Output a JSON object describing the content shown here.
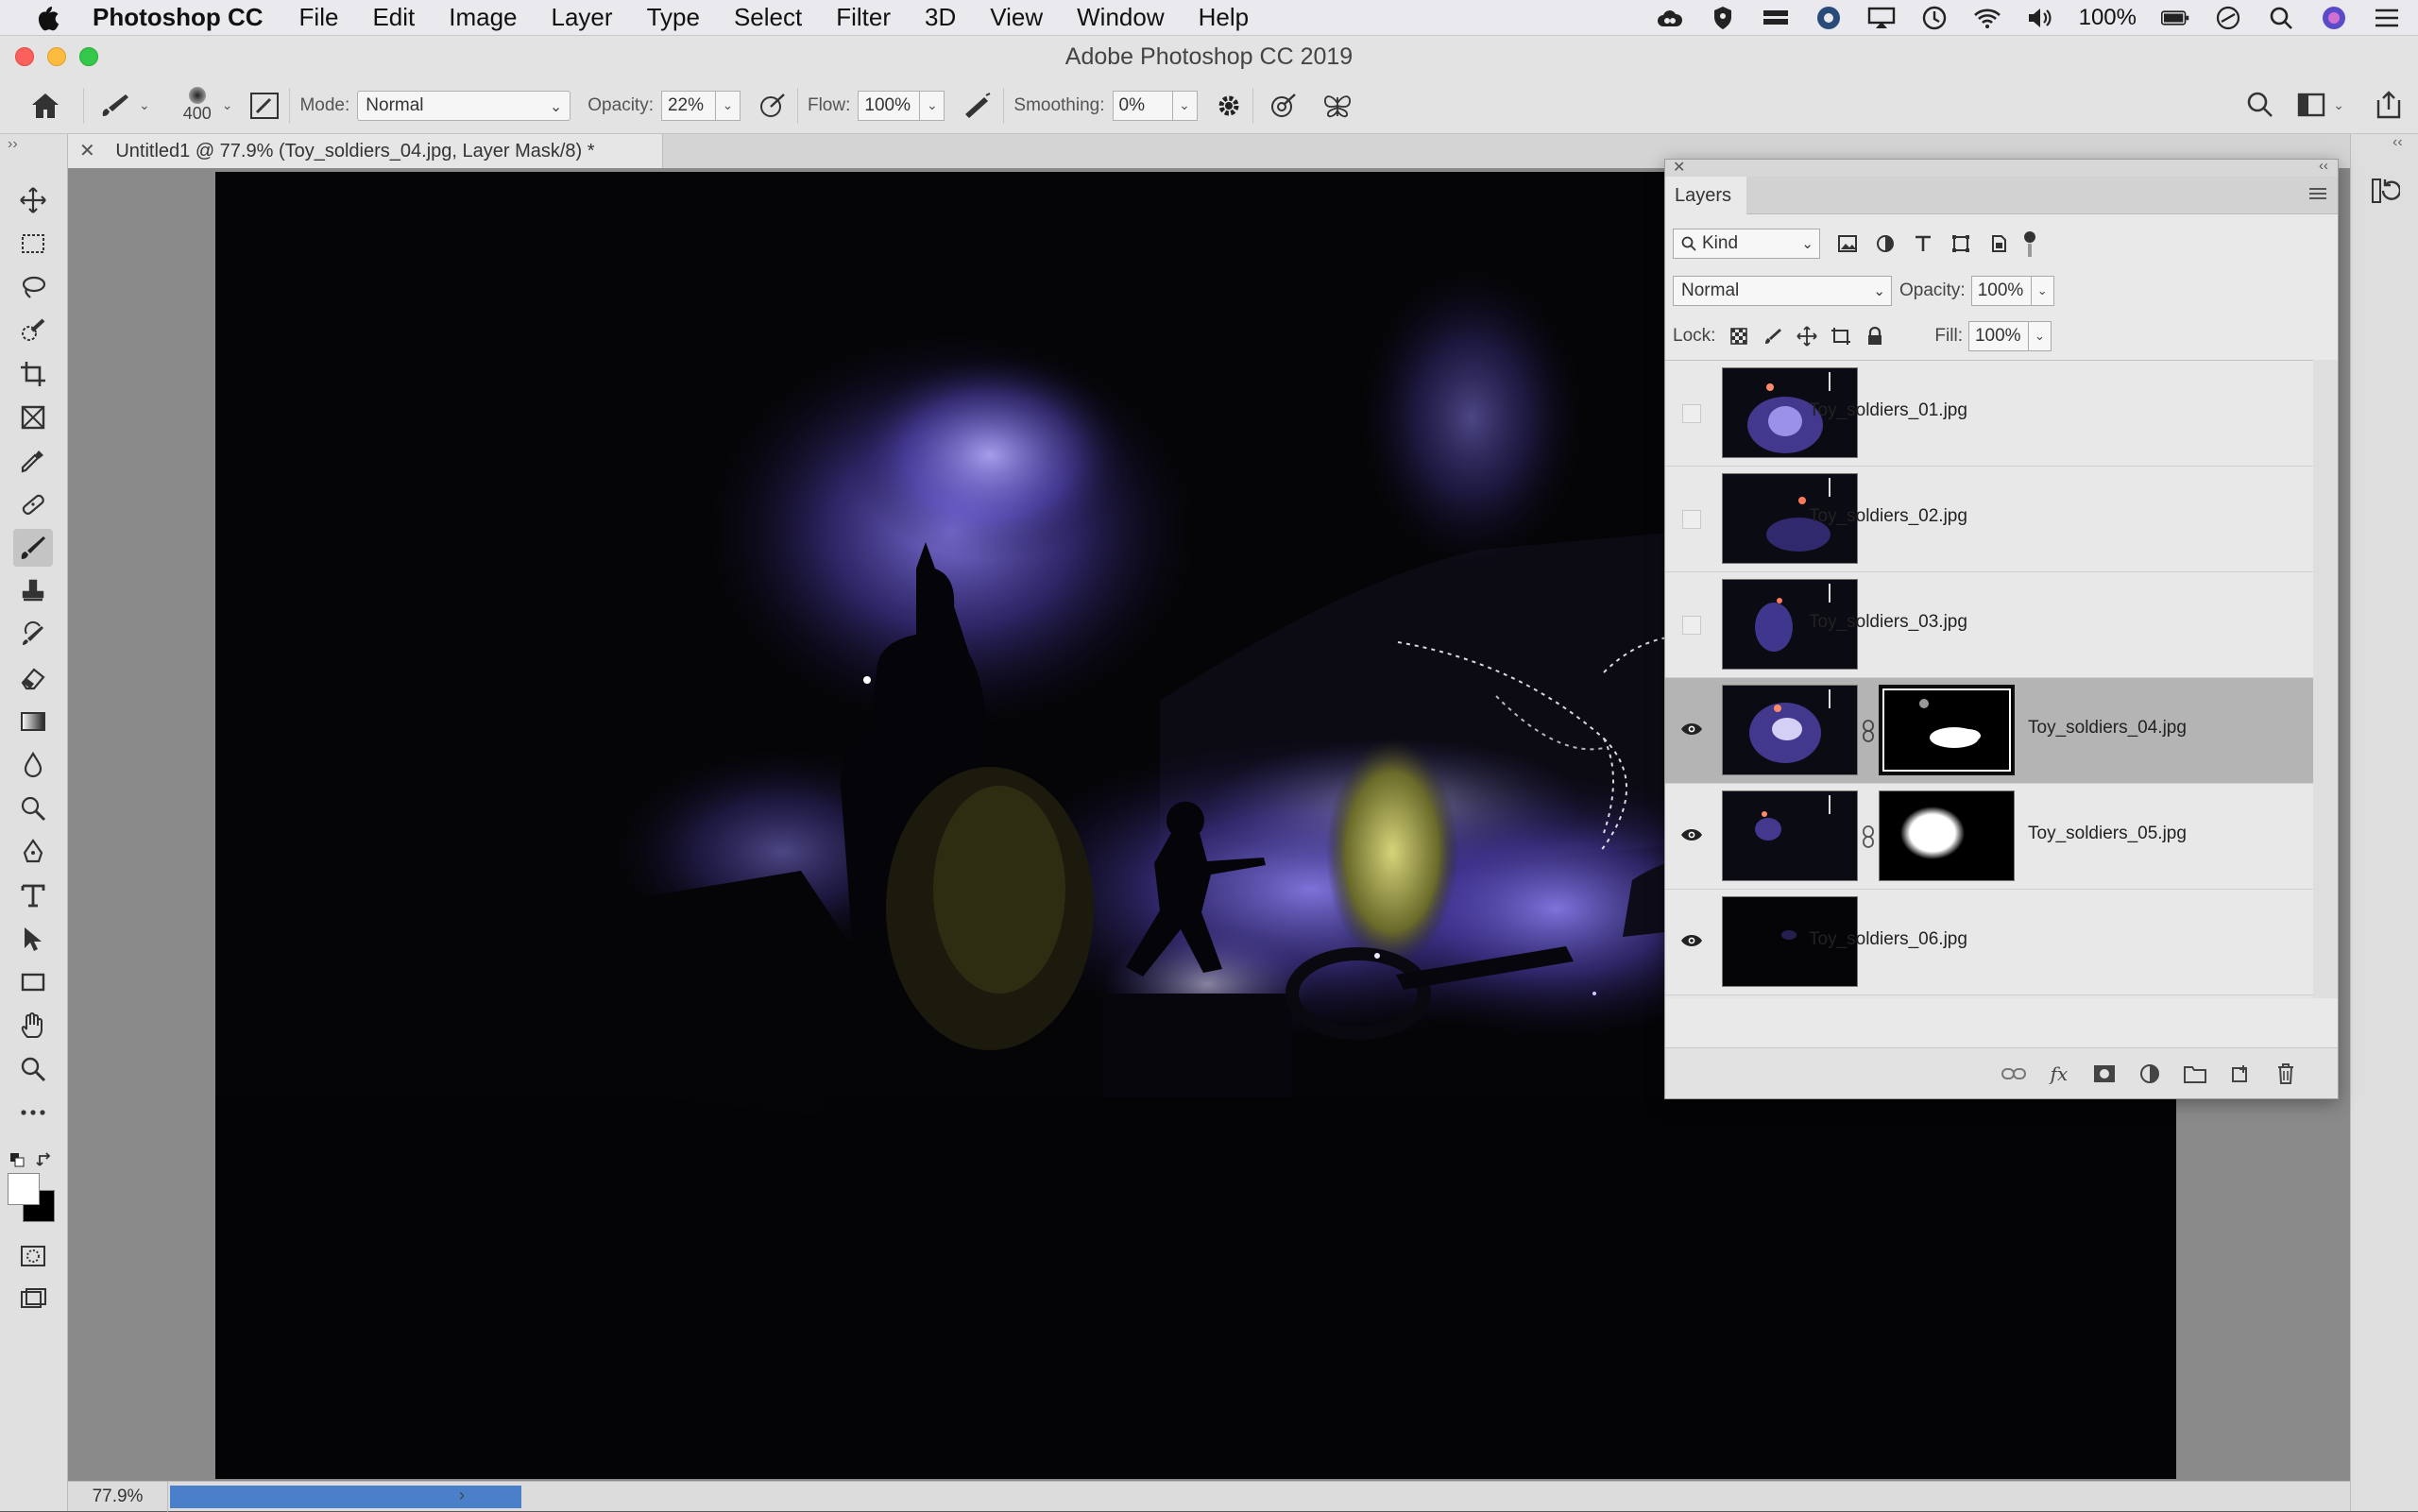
{
  "menubar": {
    "app_name": "Photoshop CC",
    "items": [
      "File",
      "Edit",
      "Image",
      "Layer",
      "Type",
      "Select",
      "Filter",
      "3D",
      "View",
      "Window",
      "Help"
    ],
    "battery": "100%"
  },
  "window": {
    "title": "Adobe Photoshop CC 2019"
  },
  "options": {
    "brush_size": "400",
    "mode_label": "Mode:",
    "mode_value": "Normal",
    "opacity_label": "Opacity:",
    "opacity_value": "22%",
    "flow_label": "Flow:",
    "flow_value": "100%",
    "smoothing_label": "Smoothing:",
    "smoothing_value": "0%"
  },
  "document": {
    "tab_title": "Untitled1 @ 77.9% (Toy_soldiers_04.jpg, Layer Mask/8) *"
  },
  "status": {
    "zoom": "77.9%"
  },
  "layers_panel": {
    "tab": "Layers",
    "filter_kind": "Kind",
    "blend_mode": "Normal",
    "opacity_label": "Opacity:",
    "opacity_value": "100%",
    "lock_label": "Lock:",
    "fill_label": "Fill:",
    "fill_value": "100%",
    "layers": [
      {
        "name": "Toy_soldiers_01.jpg",
        "visible": false,
        "has_mask": false,
        "selected": false
      },
      {
        "name": "Toy_soldiers_02.jpg",
        "visible": false,
        "has_mask": false,
        "selected": false
      },
      {
        "name": "Toy_soldiers_03.jpg",
        "visible": false,
        "has_mask": false,
        "selected": false
      },
      {
        "name": "Toy_soldiers_04.jpg",
        "visible": true,
        "has_mask": true,
        "selected": true
      },
      {
        "name": "Toy_soldiers_05.jpg",
        "visible": true,
        "has_mask": true,
        "selected": false
      },
      {
        "name": "Toy_soldiers_06.jpg",
        "visible": true,
        "has_mask": false,
        "selected": false
      }
    ]
  },
  "colors": {
    "accent_blue": "#4a7fc9",
    "canvas_bg": "#050507",
    "smoke": "#7a6ee0"
  }
}
